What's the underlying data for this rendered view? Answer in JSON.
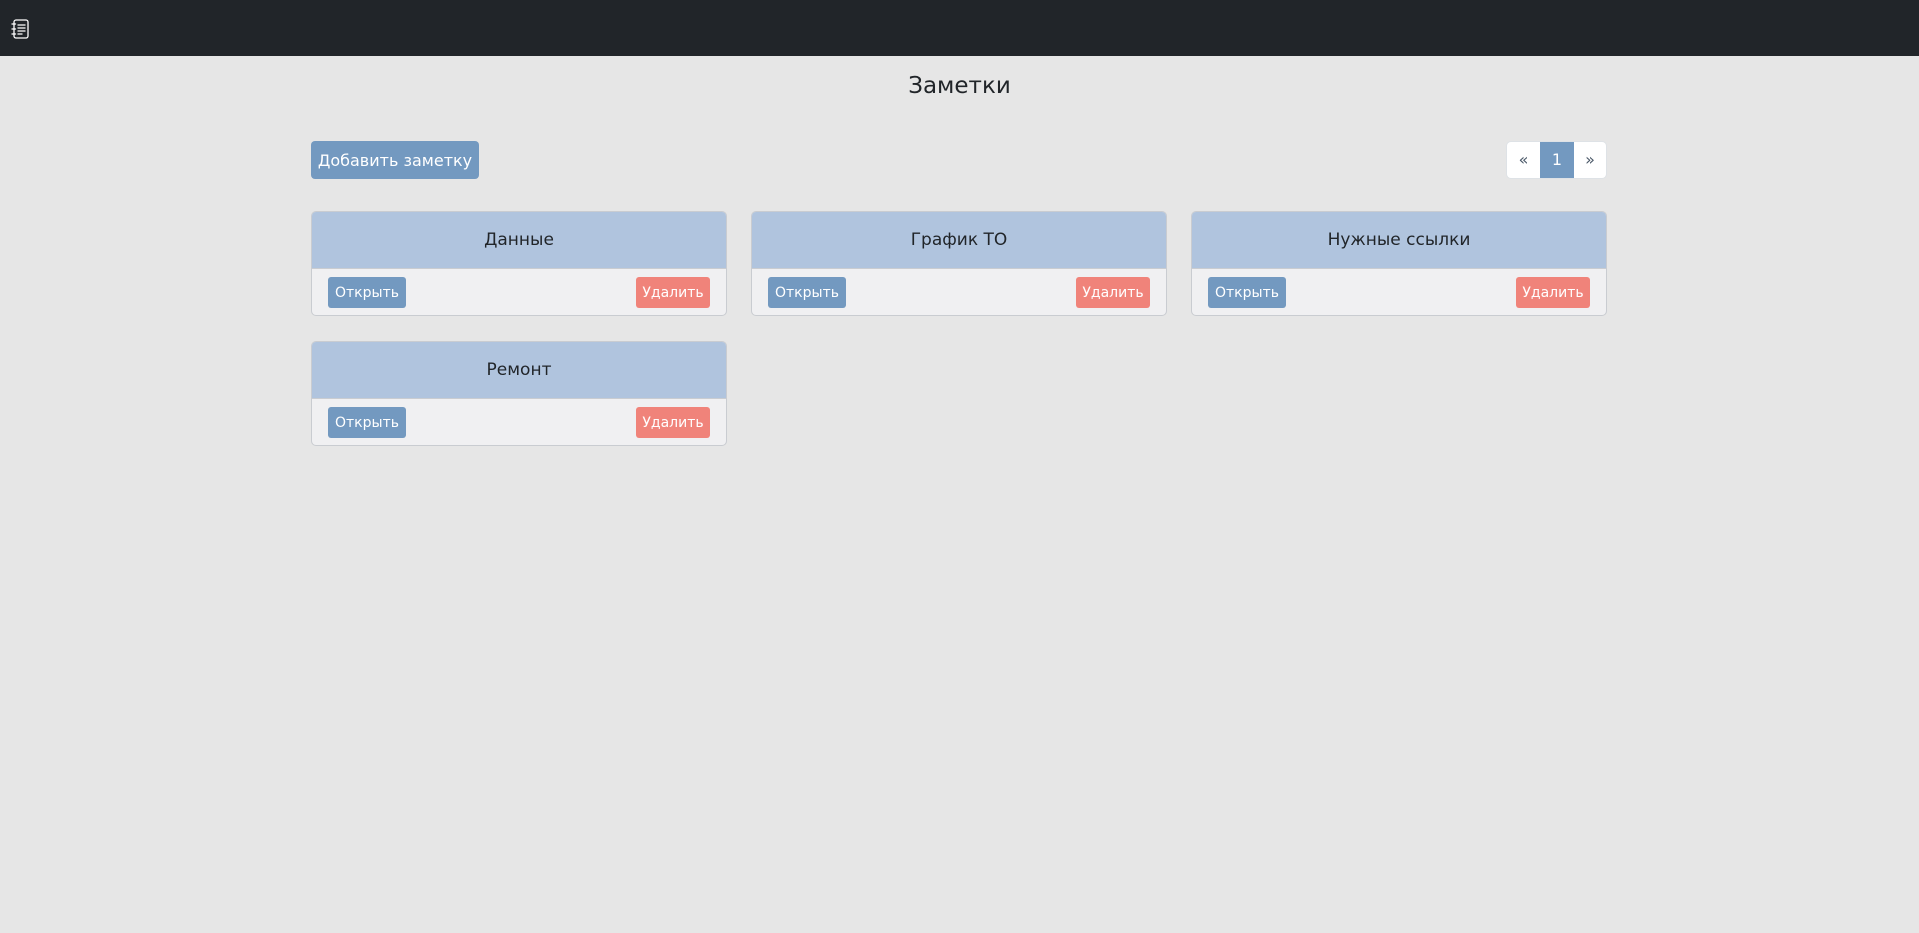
{
  "navbar": {
    "brand_icon": "notebook-icon"
  },
  "page": {
    "title": "Заметки"
  },
  "toolbar": {
    "add_label": "Добавить заметку"
  },
  "pagination": {
    "prev": "«",
    "current": "1",
    "next": "»"
  },
  "notes": [
    {
      "title": "Данные",
      "open_label": "Открыть",
      "delete_label": "Удалить"
    },
    {
      "title": "График ТО",
      "open_label": "Открыть",
      "delete_label": "Удалить"
    },
    {
      "title": "Нужные ссылки",
      "open_label": "Открыть",
      "delete_label": "Удалить"
    },
    {
      "title": "Ремонт",
      "open_label": "Открыть",
      "delete_label": "Удалить"
    }
  ],
  "colors": {
    "navbar": "#212529",
    "background": "#e6e6e6",
    "primary": "#7399c0",
    "card_header": "#b0c4de",
    "danger": "#f0837a"
  }
}
